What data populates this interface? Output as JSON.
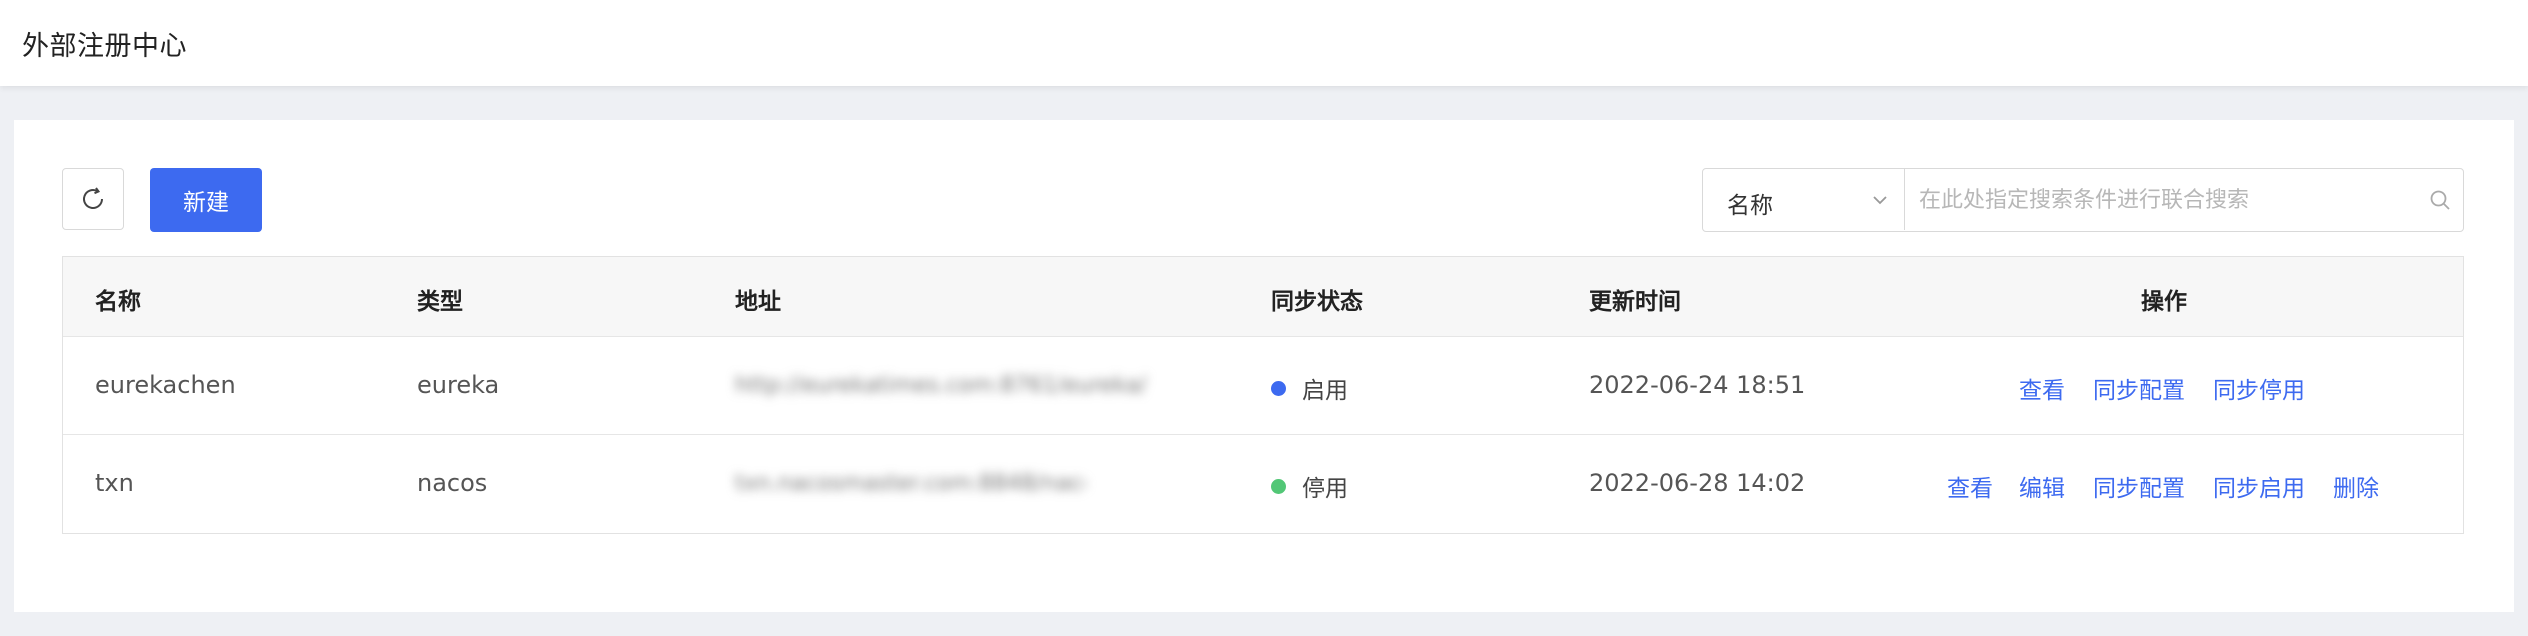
{
  "page": {
    "title": "外部注册中心"
  },
  "toolbar": {
    "new_label": "新建"
  },
  "search": {
    "field_selected": "名称",
    "placeholder": "在此处指定搜索条件进行联合搜索"
  },
  "table": {
    "columns": [
      "名称",
      "类型",
      "地址",
      "同步状态",
      "更新时间",
      "操作"
    ],
    "rows": [
      {
        "name": "eurekachen",
        "type": "eureka",
        "address": "http://eurekatimes.com:8761/eureka/",
        "status": "启用",
        "status_color": "#3d6af0",
        "updated": "2022-06-24 18:51",
        "actions": [
          "查看",
          "同步配置",
          "同步停用"
        ]
      },
      {
        "name": "txn",
        "type": "nacos",
        "address": "txn.nacosmaster.com:8848/nacos/",
        "status": "停用",
        "status_color": "#52c776",
        "updated": "2022-06-28 14:02",
        "actions": [
          "查看",
          "编辑",
          "同步配置",
          "同步启用",
          "删除"
        ]
      }
    ]
  },
  "colors": {
    "primary": "#3d6af0",
    "enabled_dot": "#3d6af0",
    "disabled_dot": "#52c776"
  },
  "icons": {
    "refresh": "refresh-icon",
    "dropdown": "chevron-down-icon",
    "search": "search-icon"
  }
}
